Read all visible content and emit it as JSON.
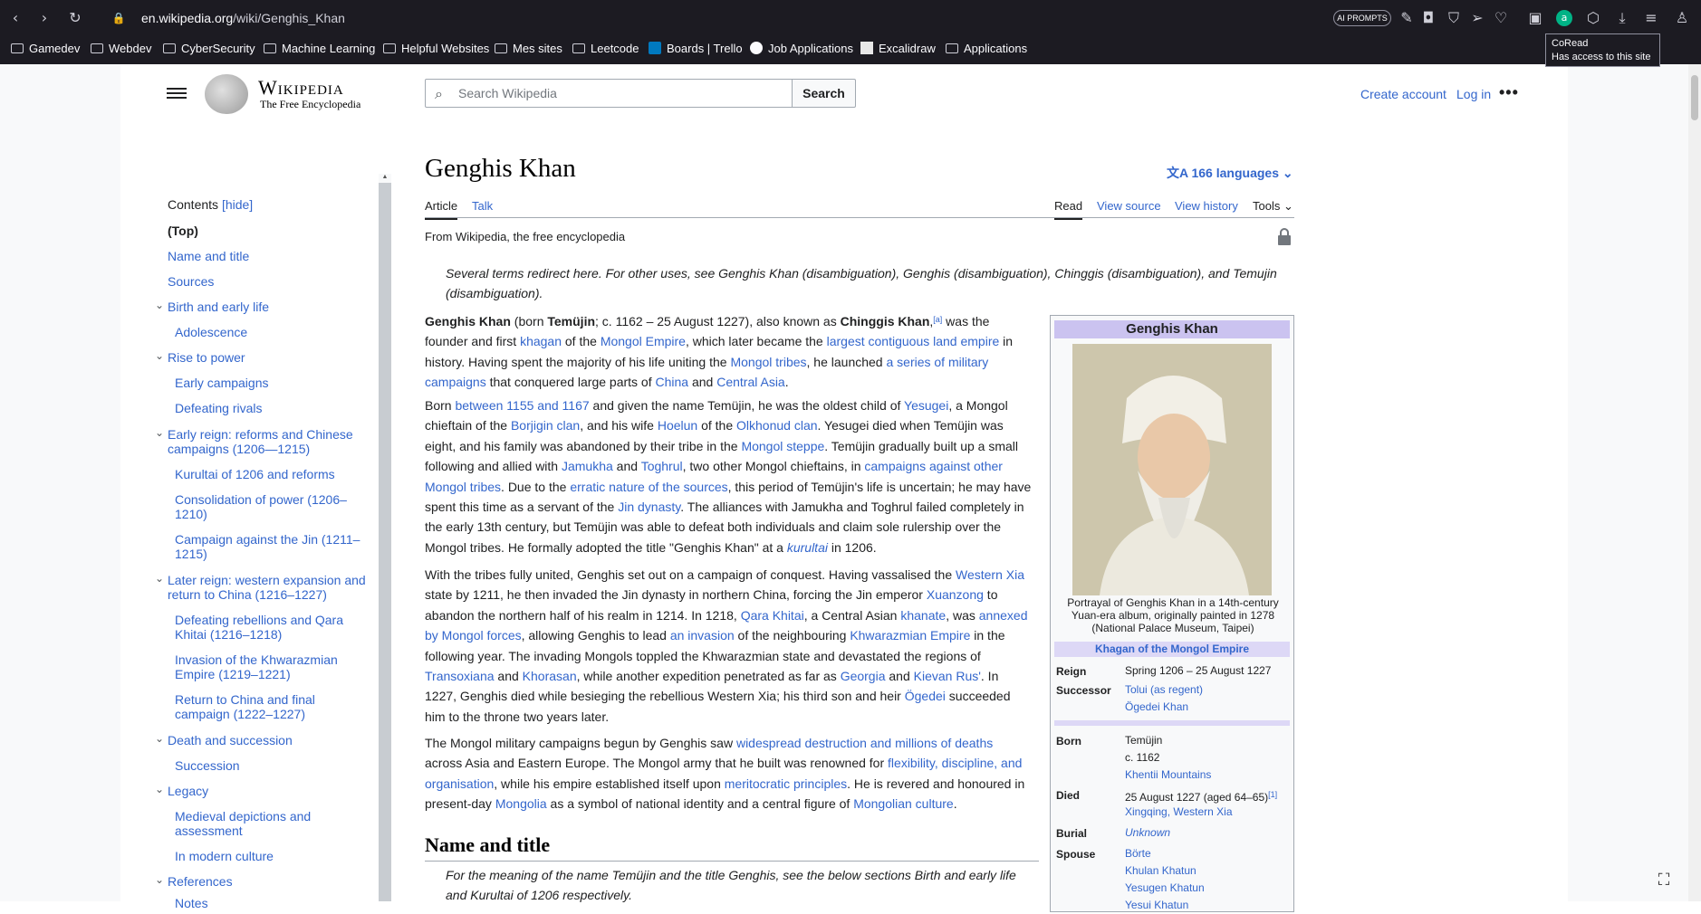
{
  "browser": {
    "url_host": "en.wikipedia.org",
    "url_path": "/wiki/Genghis_Khan",
    "ai_prompts_label": "AI PROMPTS",
    "bookmarks": [
      "Gamedev",
      "Webdev",
      "CyberSecurity",
      "Machine Learning",
      "Helpful Websites",
      "Mes sites",
      "Leetcode",
      "Boards | Trello",
      "Job Applications",
      "Excalidraw",
      "Applications"
    ],
    "tooltip_title": "CoRead",
    "tooltip_text": "Has access to this site"
  },
  "header": {
    "logo_word": "Wikipedia",
    "logo_tagline": "The Free Encyclopedia",
    "search_placeholder": "Search Wikipedia",
    "search_button": "Search",
    "create_account": "Create account",
    "login": "Log in",
    "more": "•••"
  },
  "toc": {
    "heading": "Contents",
    "hide": "[hide]",
    "items": [
      "(Top)",
      "Name and title",
      "Sources",
      "Birth and early life",
      "Adolescence",
      "Rise to power",
      "Early campaigns",
      "Defeating rivals",
      "Early reign: reforms and Chinese campaigns (1206—1215)",
      "Kurultai of 1206 and reforms",
      "Consolidation of power (1206–1210)",
      "Campaign against the Jin (1211–1215)",
      "Later reign: western expansion and return to China (1216–1227)",
      "Defeating rebellions and Qara Khitai (1216–1218)",
      "Invasion of the Khwarazmian Empire (1219–1221)",
      "Return to China and final campaign (1222–1227)",
      "Death and succession",
      "Succession",
      "Legacy",
      "Medieval depictions and assessment",
      "In modern culture",
      "References",
      "Notes"
    ]
  },
  "article": {
    "title": "Genghis Khan",
    "languages": "166 languages",
    "tabs": {
      "article": "Article",
      "talk": "Talk",
      "read": "Read",
      "view_source": "View source",
      "view_history": "View history",
      "tools": "Tools"
    },
    "from": "From Wikipedia, the free encyclopedia",
    "hatnote": "Several terms redirect here. For other uses, see Genghis Khan (disambiguation), Genghis (disambiguation), Chinggis (disambiguation), and Temujin (disambiguation).",
    "section_title": "Name and title",
    "hatnote2": "For the meaning of the name Temüjin and the title Genghis, see the below sections Birth and early life and Kurultai of 1206 respectively."
  },
  "infobox": {
    "title": "Genghis Khan",
    "caption": "Portrayal of Genghis Khan in a 14th-century Yuan-era album, originally painted in 1278 (National Palace Museum, Taipei)",
    "subheader": "Khagan of the Mongol Empire",
    "reign_label": "Reign",
    "reign": "Spring 1206 – 25 August 1227",
    "successor_label": "Successor",
    "successor1": "Tolui (as regent)",
    "successor2": "Ögedei Khan",
    "born_label": "Born",
    "born1": "Temüjin",
    "born2": "c. 1162",
    "born3": "Khentii Mountains",
    "died_label": "Died",
    "died1": "25 August 1227 (aged 64–65)",
    "died_ref": "[1]",
    "died2": "Xingqing, Western Xia",
    "burial_label": "Burial",
    "burial": "Unknown",
    "spouse_label": "Spouse",
    "spouses": [
      "Börte",
      "Khulan Khatun",
      "Yesugen Khatun",
      "Yesui Khatun"
    ]
  }
}
